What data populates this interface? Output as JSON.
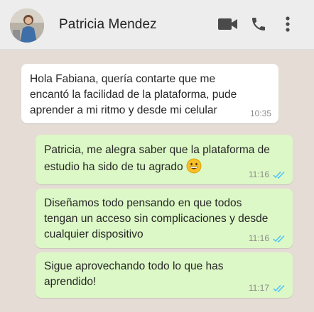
{
  "header": {
    "contact_name": "Patricia Mendez",
    "icons": [
      "avatar",
      "video-call-icon",
      "phone-call-icon",
      "more-options-icon"
    ]
  },
  "messages": [
    {
      "direction": "incoming",
      "text": "Hola Fabiana, quería contarte que me encantó la facilidad de la plataforma, pude aprender a mi ritmo y desde mi celular",
      "time": "10:35"
    },
    {
      "direction": "outgoing",
      "text": "Patricia, me alegra saber que la plataforma de estudio ha sido de tu agrado",
      "emoji": "grinning-face",
      "time": "11:16",
      "status": "read"
    },
    {
      "direction": "outgoing",
      "text": "Diseñamos todo pensando en que todos tengan un acceso sin complicaciones y desde cualquier dispositivo",
      "time": "11:16",
      "status": "read"
    },
    {
      "direction": "outgoing",
      "text": "Sigue aprovechando todo lo que has aprendido!",
      "time": "11:17",
      "status": "read"
    }
  ],
  "colors": {
    "chat_background": "#e5ddd5",
    "header_background": "#ededed",
    "incoming_bubble": "#ffffff",
    "outgoing_bubble": "#dcf8c6",
    "read_ticks": "#4fc3f7",
    "icons": "#4a4a4a"
  }
}
